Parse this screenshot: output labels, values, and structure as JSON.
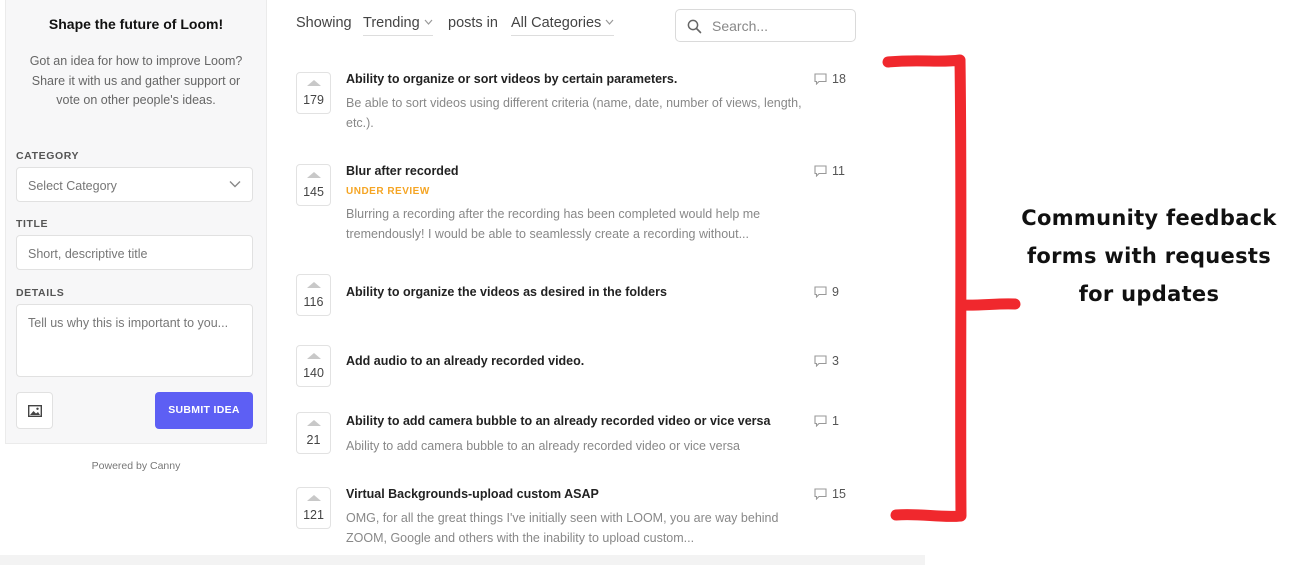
{
  "sidebar": {
    "title": "Shape the future of Loom!",
    "description": "Got an idea for how to improve Loom? Share it with us and gather support or vote on other people's ideas.",
    "category_label": "CATEGORY",
    "category_placeholder": "Select Category",
    "title_label": "TITLE",
    "title_placeholder": "Short, descriptive title",
    "details_label": "DETAILS",
    "details_placeholder": "Tell us why this is important to you...",
    "image_icon": "image-icon",
    "submit_label": "SUBMIT IDEA",
    "accent_color": "#5d5ff4"
  },
  "powered_by": "Powered by Canny",
  "topbar": {
    "showing_label": "Showing",
    "sort_value": "Trending",
    "posts_in_label": "posts in",
    "category_value": "All Categories",
    "search_placeholder": "Search..."
  },
  "posts": [
    {
      "votes": "179",
      "title": "Ability to organize or sort videos by certain parameters.",
      "status": "",
      "description": "Be able to sort videos using different criteria (name, date, number of views, length, etc.).",
      "comments": "18"
    },
    {
      "votes": "145",
      "title": "Blur after recorded",
      "status": "UNDER REVIEW",
      "description": "Blurring a recording after the recording has been completed would help me tremendously! I would be able to seamlessly create a recording without...",
      "comments": "11"
    },
    {
      "votes": "116",
      "title": "Ability to organize the videos as desired in the folders",
      "status": "",
      "description": "",
      "comments": "9"
    },
    {
      "votes": "140",
      "title": "Add audio to an already recorded video.",
      "status": "",
      "description": "",
      "comments": "3"
    },
    {
      "votes": "21",
      "title": "Ability to add camera bubble to an already recorded video or vice versa",
      "status": "",
      "description": "Ability to add camera bubble to an already recorded video or vice versa",
      "comments": "1"
    },
    {
      "votes": "121",
      "title": "Virtual Backgrounds-upload custom ASAP",
      "status": "",
      "description": "OMG, for all the great things I've initially seen with LOOM, you are way behind ZOOM, Google and others with the inability to upload custom...",
      "comments": "15"
    }
  ],
  "status_color": "#f5a524",
  "annotation": {
    "text_line1": "Community feedback",
    "text_line2": "forms with requests",
    "text_line3": "for updates",
    "bracket_color": "#f0282d"
  }
}
